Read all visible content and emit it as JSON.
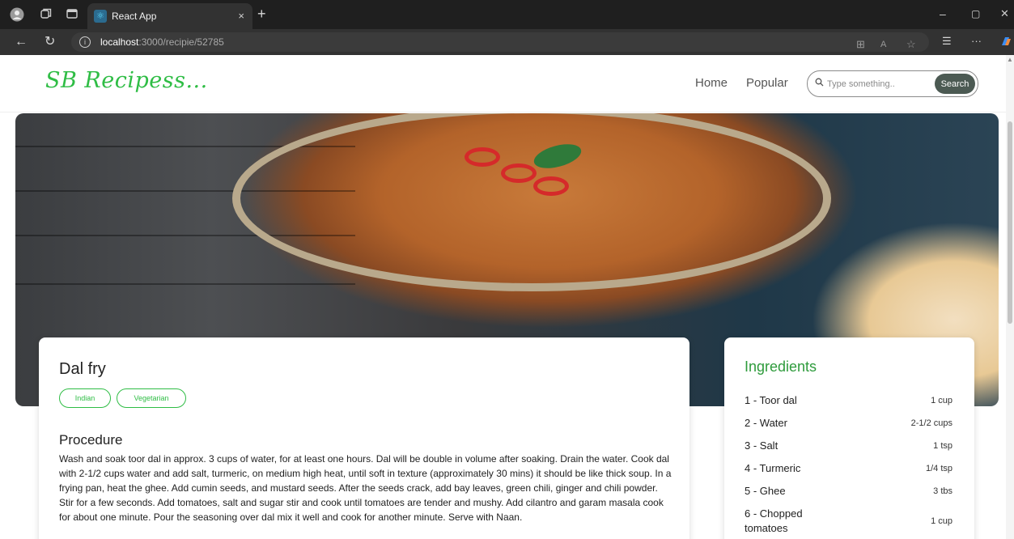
{
  "browser": {
    "tab_title": "React App",
    "tab_close": "×",
    "new_tab": "+",
    "url_host": "localhost",
    "url_path": ":3000/recipie/52785",
    "icons": [
      "profile-icon",
      "workspaces-icon",
      "tab-actions-icon",
      "react-favicon",
      "back-icon",
      "refresh-icon",
      "site-info-icon",
      "split-screen-icon",
      "read-aloud-icon",
      "favorite-icon",
      "favorites-list-icon",
      "more-icon",
      "copilot-icon"
    ],
    "window_controls": {
      "minimize": "–",
      "restore": "▢",
      "close": "✕"
    }
  },
  "header": {
    "logo": "SB Recipess...",
    "nav": {
      "home": "Home",
      "popular": "Popular"
    },
    "search": {
      "placeholder": "Type something..",
      "button": "Search"
    }
  },
  "recipe": {
    "title": "Dal fry",
    "tags": [
      "Indian",
      "Vegetarian"
    ],
    "procedure_title": "Procedure",
    "procedure": "Wash and soak toor dal in approx. 3 cups of water, for at least one hours. Dal will be double in volume after soaking. Drain the water. Cook dal with 2-1/2 cups water and add salt, turmeric, on medium high heat, until soft in texture (approximately 30 mins) it should be like thick soup. In a frying pan, heat the ghee. Add cumin seeds, and mustard seeds. After the seeds crack, add bay leaves, green chili, ginger and chili powder. Stir for a few seconds. Add tomatoes, salt and sugar stir and cook until tomatoes are tender and mushy. Add cilantro and garam masala cook for about one minute. Pour the seasoning over dal mix it well and cook for another minute. Serve with Naan."
  },
  "ingredients": {
    "title": "Ingredients",
    "items": [
      {
        "name": "1 - Toor dal",
        "qty": "1 cup"
      },
      {
        "name": "2 - Water",
        "qty": "2-1/2 cups"
      },
      {
        "name": "3 - Salt",
        "qty": "1 tsp"
      },
      {
        "name": "4 - Turmeric",
        "qty": "1/4 tsp"
      },
      {
        "name": "5 - Ghee",
        "qty": "3 tbs"
      },
      {
        "name": "6 - Chopped tomatoes",
        "qty": "1 cup"
      }
    ]
  },
  "colors": {
    "accent": "#2fbd45",
    "search_button": "#4c5a53",
    "chrome_dark": "#1f1f1f"
  }
}
